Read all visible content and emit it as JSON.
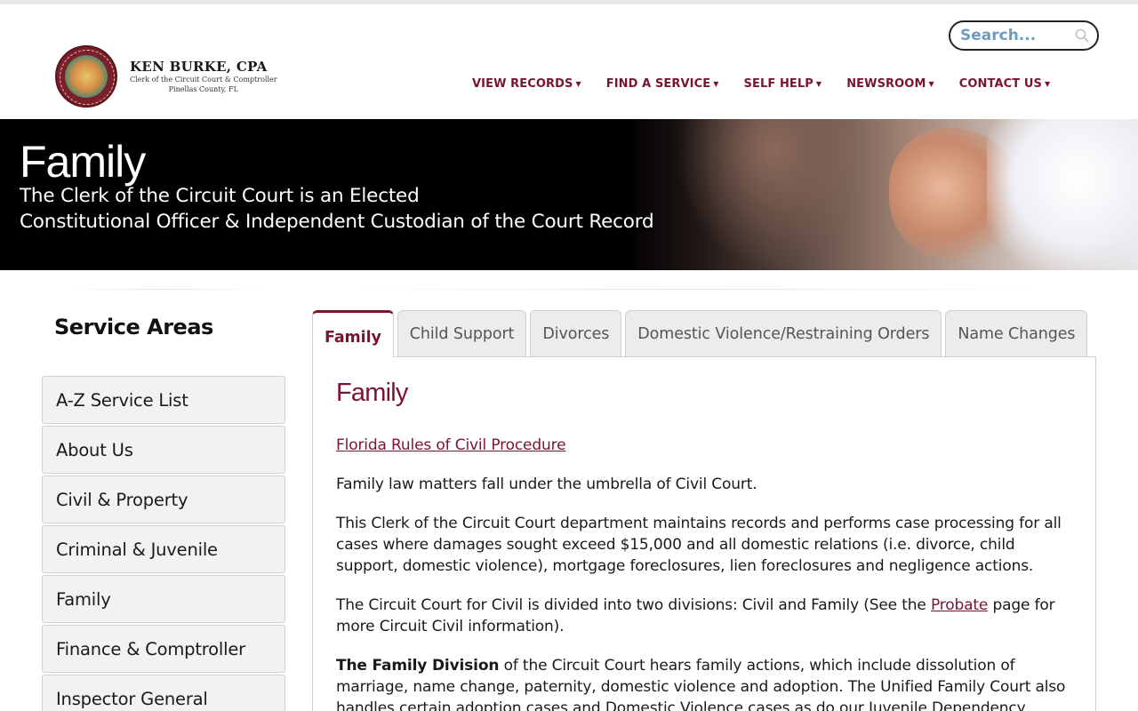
{
  "header": {
    "logo": {
      "name": "KEN BURKE, CPA",
      "sub1": "Clerk of the Circuit Court & Comptroller",
      "sub2": "Pinellas County, FL"
    },
    "search": {
      "placeholder": "Search..."
    },
    "nav": [
      {
        "label": "VIEW RECORDS"
      },
      {
        "label": "FIND A SERVICE"
      },
      {
        "label": "SELF HELP"
      },
      {
        "label": "NEWSROOM"
      },
      {
        "label": "CONTACT US"
      }
    ]
  },
  "banner": {
    "title": "Family",
    "subtitle_line1": "The Clerk of the Circuit Court is an Elected",
    "subtitle_line2": "Constitutional Officer & Independent Custodian of the Court Record"
  },
  "sidebar": {
    "title": "Service Areas",
    "items": [
      {
        "label": "A-Z Service List"
      },
      {
        "label": "About Us"
      },
      {
        "label": "Civil & Property"
      },
      {
        "label": "Criminal & Juvenile"
      },
      {
        "label": "Family"
      },
      {
        "label": "Finance & Comptroller"
      },
      {
        "label": "Inspector General"
      }
    ]
  },
  "tabs": [
    {
      "label": "Family",
      "active": true
    },
    {
      "label": "Child Support"
    },
    {
      "label": "Divorces"
    },
    {
      "label": "Domestic Violence/Restraining Orders"
    },
    {
      "label": "Name Changes"
    }
  ],
  "content": {
    "heading": "Family",
    "rules_link": "Florida Rules of Civil Procedure",
    "p1": "Family law matters fall under the umbrella of Civil Court.",
    "p2": "This Clerk of the Circuit Court department maintains records and performs case processing for all cases where damages sought exceed $15,000 and all domestic relations (i.e. divorce, child support, domestic violence), mortgage foreclosures, lien foreclosures and negligence actions.",
    "p3_before": "The Circuit Court for Civil is divided into two divisions: Civil and Family (See the ",
    "p3_link": "Probate",
    "p3_after": " page for more Circuit Civil information).",
    "p4_bold": "The Family Division",
    "p4_rest": " of the Circuit Court hears family actions, which include dissolution of marriage, name change, paternity, domestic violence and adoption. The Unified Family Court also handles certain adoption cases and Domestic Violence cases as do our Juvenile Dependency sections."
  }
}
